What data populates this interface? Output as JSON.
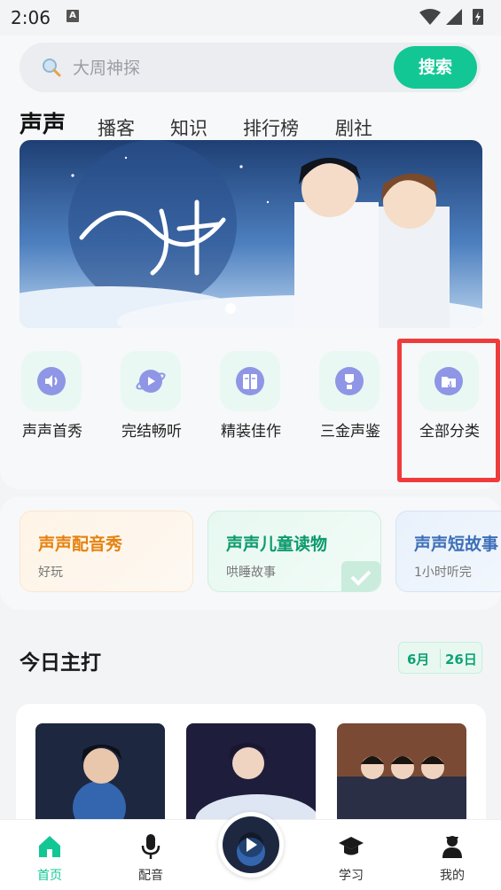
{
  "status": {
    "time": "2:06",
    "notif": "A"
  },
  "search": {
    "placeholder": "大周神探",
    "button_label": "搜索"
  },
  "tabs": [
    "声声",
    "播客",
    "知识",
    "排行榜",
    "剧社"
  ],
  "categories": [
    {
      "label": "声声首秀",
      "icon": "speaker-icon"
    },
    {
      "label": "完结畅听",
      "icon": "planet-play-icon"
    },
    {
      "label": "精装佳作",
      "icon": "book-icon"
    },
    {
      "label": "三金声鉴",
      "icon": "award-icon"
    },
    {
      "label": "全部分类",
      "icon": "folder-icon"
    }
  ],
  "feature_cards": [
    {
      "title": "声声配音秀",
      "subtitle": "好玩",
      "color": "#e5820f"
    },
    {
      "title": "声声儿童读物",
      "subtitle": "哄睡故事",
      "color": "#0b9a6c"
    },
    {
      "title": "声声短故事",
      "subtitle": "1小时听完",
      "color": "#3d6fb8"
    }
  ],
  "today": {
    "title": "今日主打",
    "month": "6月",
    "day": "26日"
  },
  "nav": [
    {
      "label": "首页",
      "icon": "home-icon"
    },
    {
      "label": "配音",
      "icon": "microphone-icon"
    },
    {
      "label": "学习",
      "icon": "graduation-cap-icon"
    },
    {
      "label": "我的",
      "icon": "profile-icon"
    }
  ],
  "colors": {
    "accent": "#13c795",
    "highlight": "#ef3b3b"
  }
}
